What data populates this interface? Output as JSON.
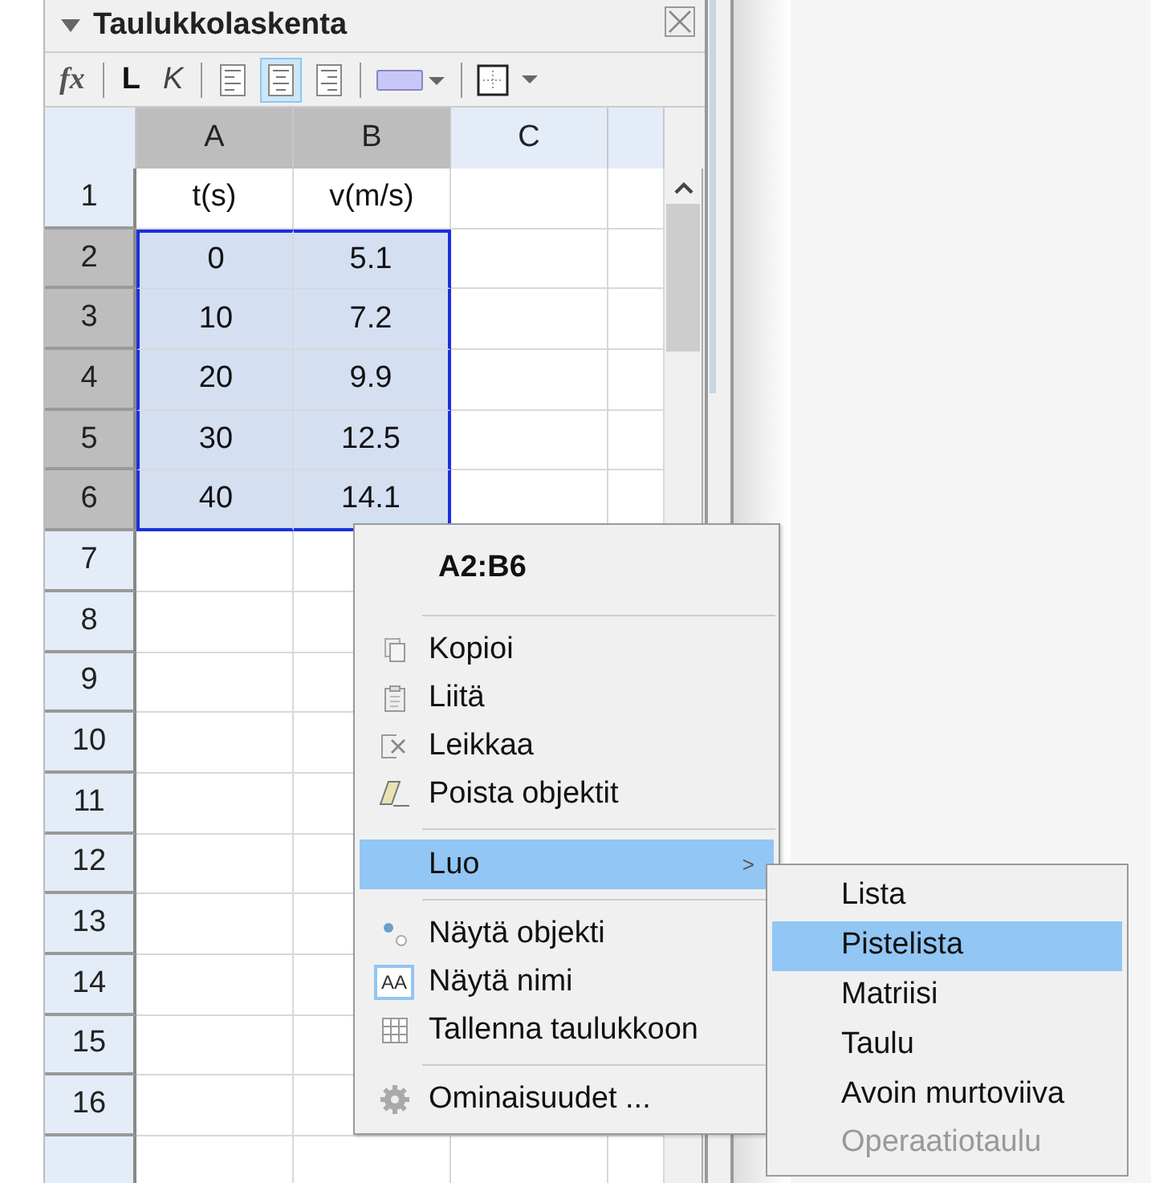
{
  "panel": {
    "title": "Taulukkolaskenta",
    "expanded": true
  },
  "toolbar": [
    {
      "kind": "formula",
      "text": "fx",
      "selected": false
    },
    {
      "kind": "sep"
    },
    {
      "kind": "bold",
      "text": "L",
      "selected": false
    },
    {
      "kind": "italic",
      "text": "K",
      "selected": false
    },
    {
      "kind": "sep"
    },
    {
      "kind": "align-left",
      "selected": false
    },
    {
      "kind": "align-center",
      "selected": true
    },
    {
      "kind": "align-right",
      "selected": false
    },
    {
      "kind": "sep"
    },
    {
      "kind": "color",
      "color": "#c8c8f8"
    },
    {
      "kind": "sep"
    },
    {
      "kind": "border"
    }
  ],
  "columns": [
    {
      "label": "A",
      "selected": true
    },
    {
      "label": "B",
      "selected": true
    },
    {
      "label": "C",
      "selected": false
    }
  ],
  "rows": [
    {
      "number": "1",
      "selected": false,
      "cells": [
        {
          "text": "t(s)",
          "selected": false
        },
        {
          "text": "v(m/s)",
          "selected": false
        }
      ]
    },
    {
      "number": "2",
      "selected": true,
      "cells": [
        {
          "text": "0",
          "selected": true
        },
        {
          "text": "5.1",
          "selected": true
        }
      ]
    },
    {
      "number": "3",
      "selected": true,
      "cells": [
        {
          "text": "10",
          "selected": true
        },
        {
          "text": "7.2",
          "selected": true
        }
      ]
    },
    {
      "number": "4",
      "selected": true,
      "cells": [
        {
          "text": "20",
          "selected": true
        },
        {
          "text": "9.9",
          "selected": true
        }
      ]
    },
    {
      "number": "5",
      "selected": true,
      "cells": [
        {
          "text": "30",
          "selected": true
        },
        {
          "text": "12.5",
          "selected": true
        }
      ]
    },
    {
      "number": "6",
      "selected": true,
      "cells": [
        {
          "text": "40",
          "selected": true
        },
        {
          "text": "14.1",
          "selected": true
        }
      ]
    },
    {
      "number": "7",
      "selected": false
    },
    {
      "number": "8",
      "selected": false
    },
    {
      "number": "9",
      "selected": false
    },
    {
      "number": "10",
      "selected": false
    },
    {
      "number": "11",
      "selected": false
    },
    {
      "number": "12",
      "selected": false
    },
    {
      "number": "13",
      "selected": false
    },
    {
      "number": "14",
      "selected": false
    },
    {
      "number": "15",
      "selected": false
    },
    {
      "number": "16",
      "selected": false
    }
  ],
  "context_menu": {
    "title": "A2:B6",
    "items": [
      {
        "kind": "separator"
      },
      {
        "kind": "copy",
        "label": "Kopioi",
        "selected": false
      },
      {
        "kind": "paste",
        "label": "Liitä",
        "selected": false
      },
      {
        "kind": "cut",
        "label": "Leikkaa",
        "selected": false
      },
      {
        "kind": "eraser",
        "label": "Poista objektit",
        "selected": false
      },
      {
        "kind": "separator"
      },
      {
        "kind": "submenu",
        "label": "Luo",
        "arrow": ">",
        "selected": true
      },
      {
        "kind": "separator"
      },
      {
        "kind": "points",
        "label": "Näytä objekti",
        "selected": false
      },
      {
        "kind": "label",
        "label": "Näytä nimi",
        "icon_text": "AA",
        "selected": false
      },
      {
        "kind": "table",
        "label": "Tallenna taulukkoon",
        "selected": false
      },
      {
        "kind": "separator"
      },
      {
        "kind": "gear",
        "label": "Ominaisuudet ...",
        "selected": false
      }
    ]
  },
  "submenu": [
    {
      "label": "Lista",
      "selected": false,
      "disabled": false
    },
    {
      "label": "Pistelista",
      "selected": true,
      "disabled": false
    },
    {
      "label": "Matriisi",
      "selected": false,
      "disabled": false
    },
    {
      "label": "Taulu",
      "selected": false,
      "disabled": false
    },
    {
      "label": "Avoin murtoviiva",
      "selected": false,
      "disabled": false
    },
    {
      "label": "Operaatiotaulu",
      "selected": false,
      "disabled": true
    }
  ]
}
